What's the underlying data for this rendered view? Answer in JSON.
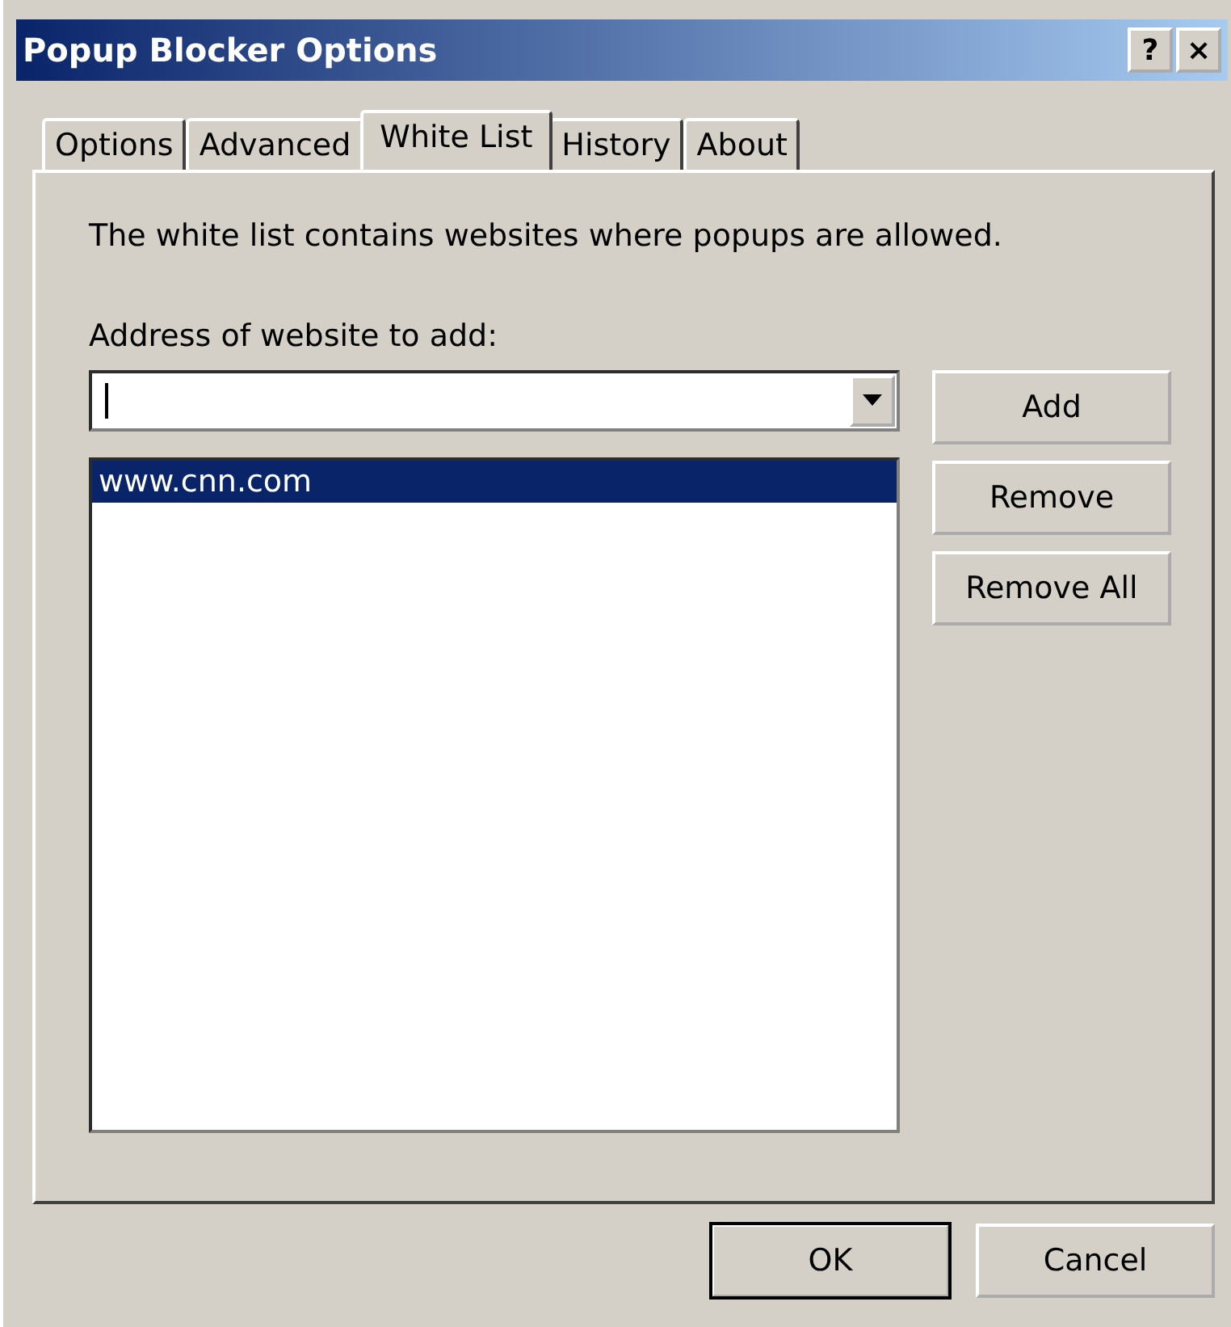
{
  "window": {
    "title": "Popup Blocker Options",
    "title_buttons": [
      "?",
      "×"
    ]
  },
  "tabs": [
    {
      "label": "Options",
      "selected": false
    },
    {
      "label": "Advanced",
      "selected": false
    },
    {
      "label": "White List",
      "selected": true
    },
    {
      "label": "History",
      "selected": false
    },
    {
      "label": "About",
      "selected": false
    }
  ],
  "description": "The white list contains websites where popups are allowed.",
  "address": {
    "label": "Address of website to add:"
  },
  "side_buttons": [
    "Add",
    "Remove",
    "Remove All"
  ],
  "sites": [
    {
      "label": "www.cnn.com",
      "selected": true
    }
  ],
  "footer_buttons": [
    {
      "label": "OK",
      "default": true
    },
    {
      "label": "Cancel",
      "default": false
    }
  ]
}
